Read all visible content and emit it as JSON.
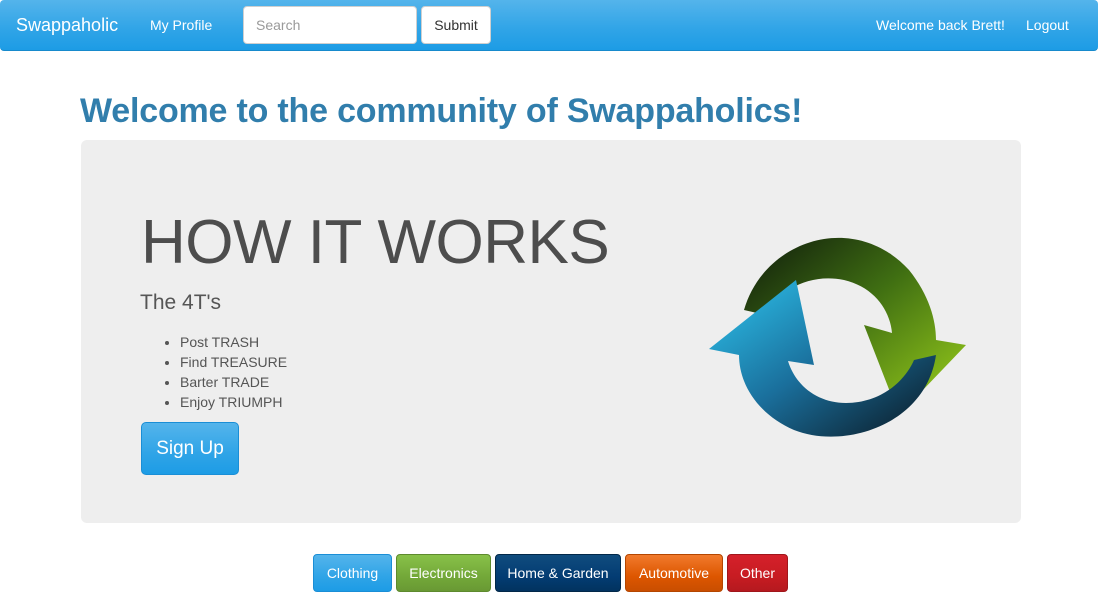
{
  "navbar": {
    "brand": "Swappaholic",
    "profile_link": "My Profile",
    "search_placeholder": "Search",
    "submit_label": "Submit",
    "welcome_text": "Welcome back Brett!",
    "logout_link": "Logout"
  },
  "main": {
    "title": "Welcome to the community of Swappaholics!"
  },
  "jumbotron": {
    "heading": "HOW IT WORKS",
    "subtitle": "The 4T's",
    "steps": [
      "Post TRASH",
      "Find TREASURE",
      "Barter TRADE",
      "Enjoy TRIUMPH"
    ],
    "signup_label": "Sign Up",
    "logo_icon": "swap-arrows-icon"
  },
  "categories": [
    {
      "label": "Clothing",
      "color": "#2fa4e7"
    },
    {
      "label": "Electronics",
      "color": "#73a839"
    },
    {
      "label": "Home & Garden",
      "color": "#033c73"
    },
    {
      "label": "Automotive",
      "color": "#dd5600"
    },
    {
      "label": "Other",
      "color": "#c71c22"
    }
  ]
}
